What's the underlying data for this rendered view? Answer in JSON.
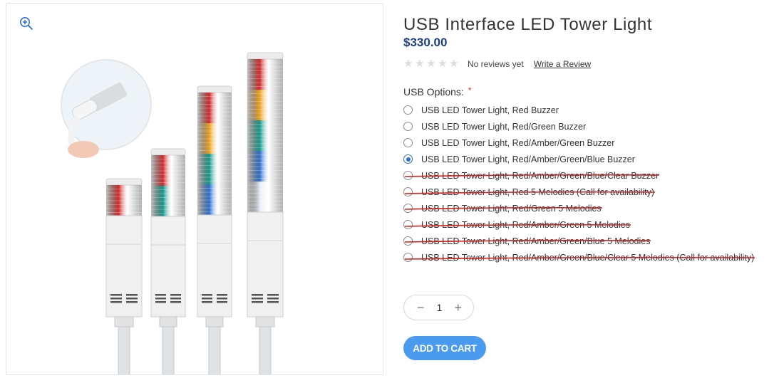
{
  "product": {
    "title": "USB Interface LED Tower Light",
    "price": "$330.00",
    "rating_stars": 0,
    "no_reviews_text": "No reviews yet",
    "write_review_label": "Write a Review"
  },
  "gallery": {
    "zoom_icon": "zoom-in-icon"
  },
  "options": {
    "label": "USB Options:",
    "required_mark": "*",
    "items": [
      {
        "label": "USB LED Tower Light, Red Buzzer",
        "selected": false,
        "struck": false
      },
      {
        "label": "USB LED Tower Light, Red/Green Buzzer",
        "selected": false,
        "struck": false
      },
      {
        "label": "USB LED Tower Light, Red/Amber/Green Buzzer",
        "selected": false,
        "struck": false
      },
      {
        "label": "USB LED Tower Light, Red/Amber/Green/Blue Buzzer",
        "selected": true,
        "struck": false
      },
      {
        "label": "USB LED Tower Light, Red/Amber/Green/Blue/Clear Buzzer",
        "selected": false,
        "struck": true
      },
      {
        "label": "USB LED Tower Light, Red 5 Melodies (Call for availability)",
        "selected": false,
        "struck": true
      },
      {
        "label": "USB LED Tower Light, Red/Green 5 Melodies",
        "selected": false,
        "struck": true
      },
      {
        "label": "USB LED Tower Light, Red/Amber/Green 5 Melodies",
        "selected": false,
        "struck": true
      },
      {
        "label": "USB LED Tower Light, Red/Amber/Green/Blue 5 Melodies",
        "selected": false,
        "struck": true
      },
      {
        "label": "USB LED Tower Light, Red/Amber/Green/Blue/Clear 5 Melodies (Call for availability)",
        "selected": false,
        "struck": true
      }
    ]
  },
  "quantity": {
    "value": "1",
    "decrement_label": "−",
    "increment_label": "+"
  },
  "cart": {
    "add_label": "ADD TO CART"
  },
  "colors": {
    "price": "#1f3f86",
    "accent": "#4a9af0",
    "strike": "#d41f1f",
    "required": "#d0312d",
    "tier_red": "#d32a2a",
    "tier_amber": "#f0a11c",
    "tier_green": "#14998a",
    "tier_blue": "#2b6fd0",
    "tier_clear": "#e4edf4"
  }
}
